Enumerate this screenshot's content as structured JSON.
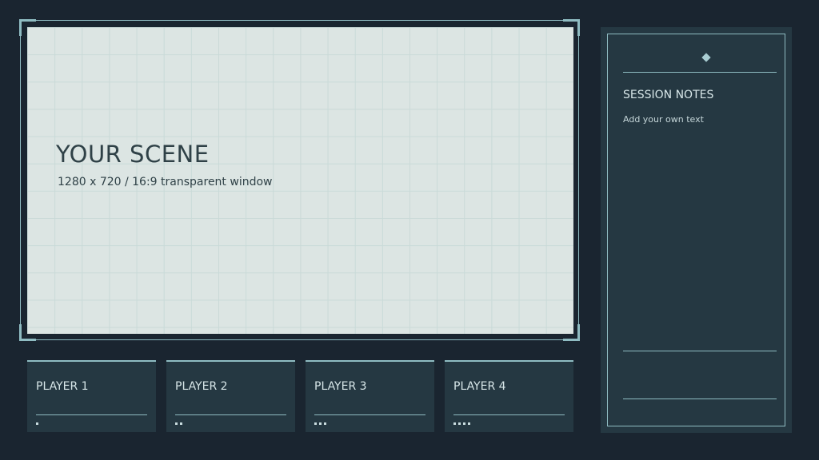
{
  "scene": {
    "title": "YOUR SCENE",
    "subtitle": "1280 x 720 / 16:9 transparent window"
  },
  "players": [
    {
      "label": "PLAYER 1",
      "dots": 1
    },
    {
      "label": "PLAYER 2",
      "dots": 2
    },
    {
      "label": "PLAYER 3",
      "dots": 3
    },
    {
      "label": "PLAYER 4",
      "dots": 4
    }
  ],
  "notes": {
    "icon": "diamond-icon",
    "title": "SESSION NOTES",
    "text": "Add your own text"
  },
  "colors": {
    "background": "#1a2530",
    "panel": "#253842",
    "accent": "#8fbcc2",
    "scene_window": "#dce5e3",
    "text_light": "#d7e6e8",
    "text_dark": "#2f4147"
  }
}
